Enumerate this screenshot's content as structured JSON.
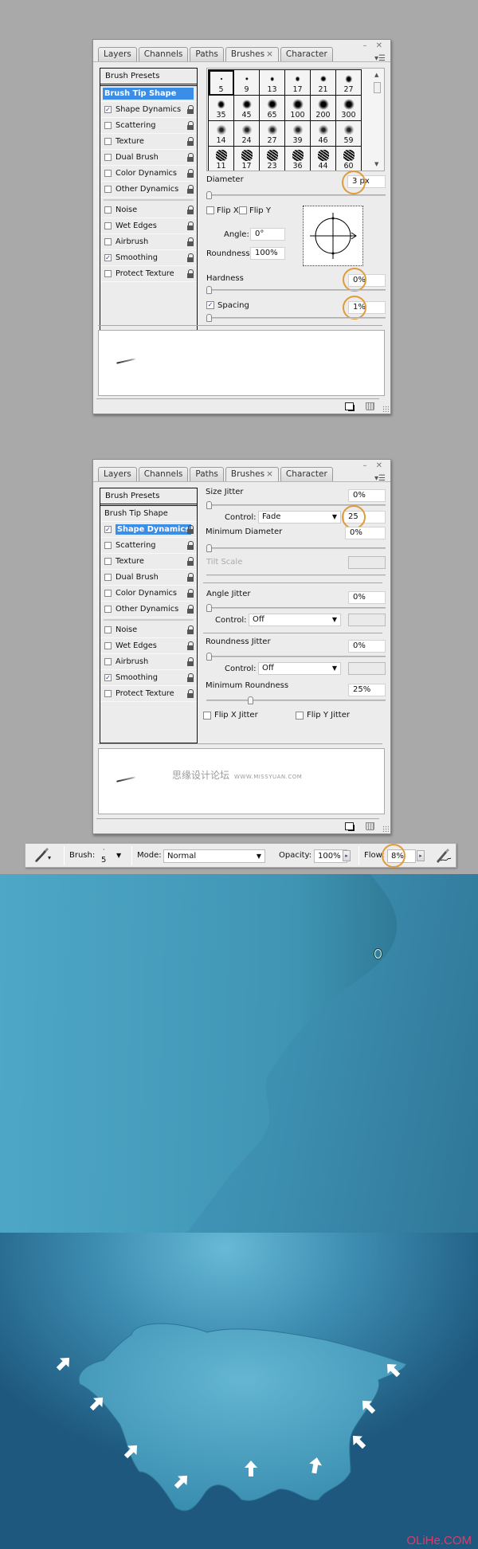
{
  "panels": {
    "tabs": [
      {
        "label": "Layers"
      },
      {
        "label": "Channels"
      },
      {
        "label": "Paths"
      },
      {
        "label": "Brushes",
        "active": true,
        "close": "×"
      },
      {
        "label": "Character"
      }
    ],
    "window_controls": "– ✕",
    "menu_icon": "▾☰",
    "list": {
      "presets": "Brush Presets",
      "items": [
        {
          "label": "Brush Tip Shape"
        },
        {
          "label": "Shape Dynamics",
          "checked": true
        },
        {
          "label": "Scattering",
          "checked": false
        },
        {
          "label": "Texture",
          "checked": false
        },
        {
          "label": "Dual Brush",
          "checked": false
        },
        {
          "label": "Color Dynamics",
          "checked": false
        },
        {
          "label": "Other Dynamics",
          "checked": false
        },
        {
          "label": "Noise",
          "checked": false
        },
        {
          "label": "Wet Edges",
          "checked": false
        },
        {
          "label": "Airbrush",
          "checked": false
        },
        {
          "label": "Smoothing",
          "checked": true
        },
        {
          "label": "Protect Texture",
          "checked": false
        }
      ]
    }
  },
  "panel1": {
    "selected_item": "Brush Tip Shape",
    "brush_grid": [
      "5",
      "9",
      "13",
      "17",
      "21",
      "27",
      "35",
      "45",
      "65",
      "100",
      "200",
      "300",
      "14",
      "24",
      "27",
      "39",
      "46",
      "59",
      "11",
      "17",
      "23",
      "36",
      "44",
      "60"
    ],
    "selected_brush": "5",
    "diameter_label": "Diameter",
    "diameter_value": "3 px",
    "flip_x": "Flip X",
    "flip_y": "Flip Y",
    "angle_label": "Angle:",
    "angle_value": "0°",
    "roundness_label": "Roundness:",
    "roundness_value": "100%",
    "hardness_label": "Hardness",
    "hardness_value": "0%",
    "spacing_label": "Spacing",
    "spacing_checked": true,
    "spacing_value": "1%"
  },
  "panel2": {
    "selected_item": "Shape Dynamics",
    "size_jitter_label": "Size Jitter",
    "size_jitter_value": "0%",
    "control_label": "Control:",
    "size_control": "Fade",
    "fade_steps": "25",
    "min_diameter_label": "Minimum Diameter",
    "min_diameter_value": "0%",
    "tilt_scale_label": "Tilt Scale",
    "angle_jitter_label": "Angle Jitter",
    "angle_jitter_value": "0%",
    "angle_control": "Off",
    "roundness_jitter_label": "Roundness Jitter",
    "roundness_jitter_value": "0%",
    "roundness_control": "Off",
    "min_roundness_label": "Minimum Roundness",
    "min_roundness_value": "25%",
    "min_roundness_slider": 0.25,
    "flip_x_jitter": "Flip X Jitter",
    "flip_y_jitter": "Flip Y Jitter",
    "watermark_cn": "思缘设计论坛",
    "watermark_url": "WWW.MISSYUAN.COM"
  },
  "toolbar": {
    "brush_label": "Brush:",
    "brush_size": "5",
    "mode_label": "Mode:",
    "mode_value": "Normal",
    "opacity_label": "Opacity:",
    "opacity_value": "100%",
    "flow_label": "Flow:",
    "flow_value": "8%"
  },
  "canvas": {
    "watermark": "OLiHe.COM"
  },
  "colors": {
    "selection": "#3a8ee8",
    "highlight_ring": "#e09b3c",
    "canvas_blue": "#3d8fb0"
  }
}
